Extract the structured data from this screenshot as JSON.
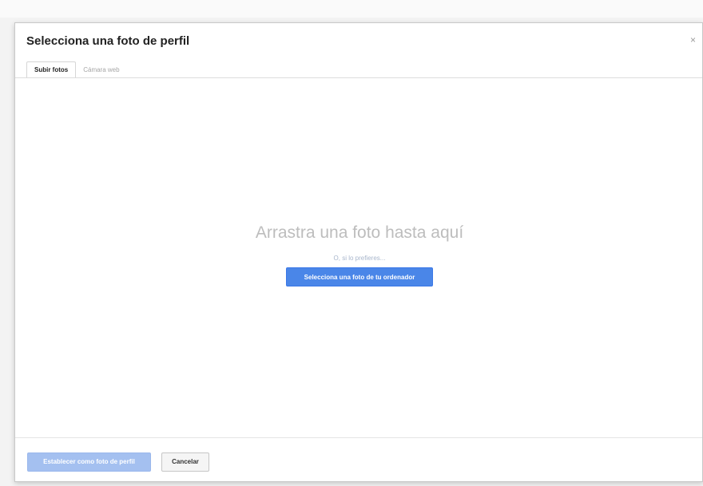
{
  "dialog": {
    "title": "Selecciona una foto de perfil",
    "close_label": "×"
  },
  "tabs": [
    {
      "label": "Subir fotos",
      "active": true
    },
    {
      "label": "Cámara web",
      "active": false
    }
  ],
  "drop_area": {
    "heading": "Arrastra una foto hasta aquí",
    "or_text": "O, si lo prefieres...",
    "select_button_label": "Selecciona una foto de tu ordenador"
  },
  "footer": {
    "set_button_label": "Establecer como foto de perfil",
    "cancel_button_label": "Cancelar"
  },
  "colors": {
    "primary_button": "#4a86e8",
    "disabled_button": "#a4c0f0",
    "heading_gray": "#bdbdbd"
  }
}
